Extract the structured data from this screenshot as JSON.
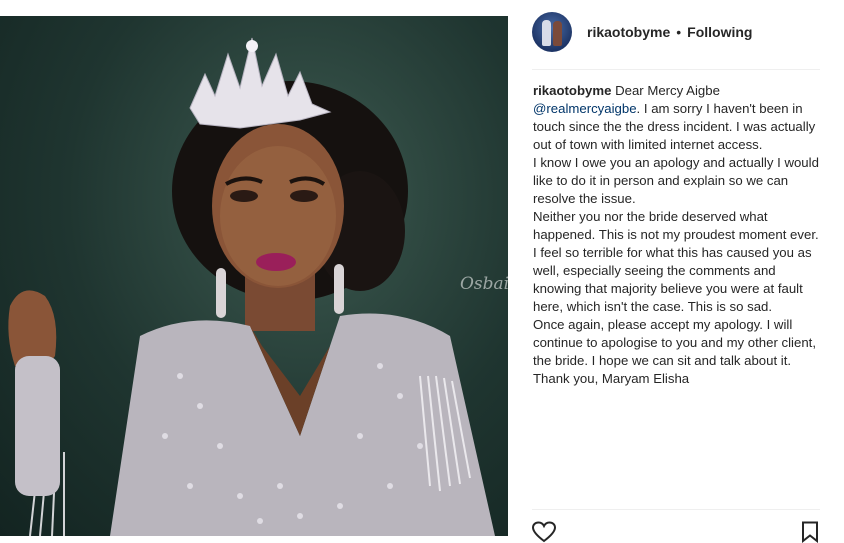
{
  "post": {
    "username": "rikaotobyme",
    "separator": "•",
    "follow_status": "Following",
    "watermark": "Osbait",
    "caption": {
      "username": "rikaotobyme",
      "intro": "Dear Mercy Aigbe",
      "mention": "@realmercyaigbe",
      "p1_rest": ". I am sorry I haven't been in touch since the the dress incident. I was actually out of town with limited internet access.",
      "p2": "I know I owe you an apology and actually I would like to do it in person and explain so we can resolve the issue.",
      "p3": "Neither you nor the bride deserved what happened. This is not my proudest moment ever. I feel so terrible for what this has caused you as well, especially seeing the comments and knowing that majority believe you were at fault here, which isn't the case. This is so sad.",
      "p4": "Once again, please accept my apology. I will continue to apologise to you and my other client, the bride. I hope we can sit and talk about it.",
      "p5": "Thank you, Maryam Elisha"
    }
  },
  "icons": {
    "like": "heart-outline-icon",
    "save": "bookmark-outline-icon"
  }
}
